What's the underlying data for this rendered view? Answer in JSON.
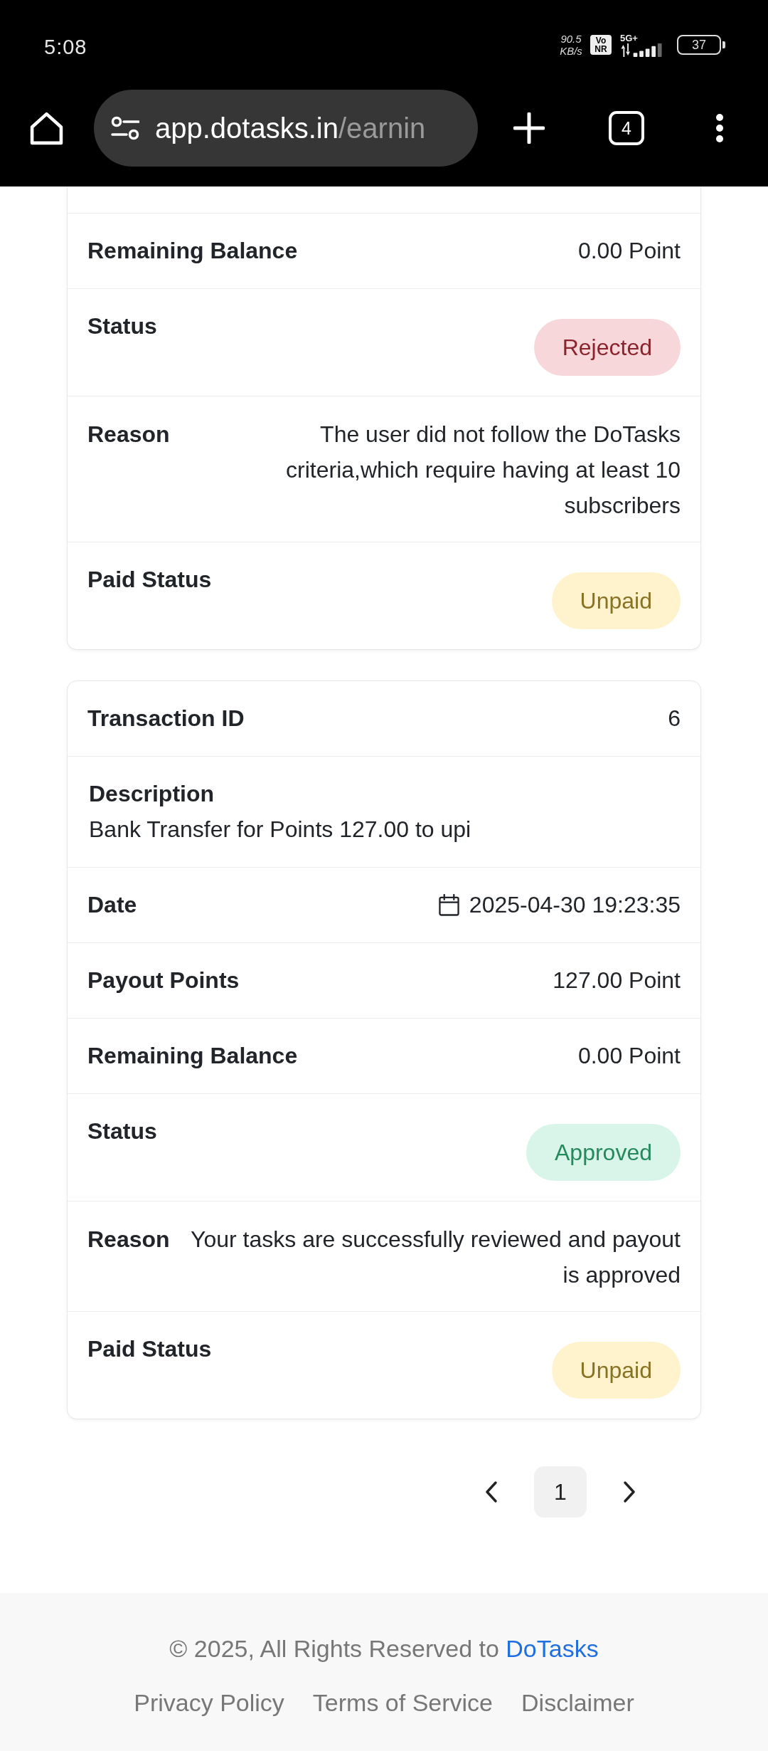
{
  "status_bar": {
    "time": "5:08",
    "network_speed": "90.5 KB/s",
    "voice_badge": "Vo NR",
    "network_type": "5G+",
    "battery": "37"
  },
  "browser_bar": {
    "url_host": "app.dotasks.in",
    "url_path": "/earnin",
    "tab_count": "4"
  },
  "cards": [
    {
      "clipped": true,
      "rows": [
        {
          "kind": "text",
          "label": "Remaining Balance",
          "value": "0.00 Point"
        },
        {
          "kind": "badge",
          "label": "Status",
          "value": "Rejected",
          "color": "#f8d7da"
        },
        {
          "kind": "reason",
          "label": "Reason",
          "value": "The user did not follow the DoTasks criteria,which require having at least 10 subscribers"
        },
        {
          "kind": "badge",
          "label": "Paid Status",
          "value": "Unpaid",
          "color": "#fff3cd"
        }
      ]
    },
    {
      "clipped": false,
      "rows": [
        {
          "kind": "text",
          "label": "Transaction ID",
          "value": "6"
        },
        {
          "kind": "description",
          "label": "Description",
          "value": "Bank Transfer for Points 127.00 to upi"
        },
        {
          "kind": "date",
          "label": "Date",
          "value": "2025-04-30 19:23:35"
        },
        {
          "kind": "text",
          "label": "Payout Points",
          "value": "127.00 Point"
        },
        {
          "kind": "text",
          "label": "Remaining Balance",
          "value": "0.00 Point"
        },
        {
          "kind": "badge",
          "label": "Status",
          "value": "Approved",
          "color": "#d9f5e9"
        },
        {
          "kind": "reason",
          "label": "Reason",
          "value": "Your tasks are successfully reviewed and payout is approved"
        },
        {
          "kind": "badge",
          "label": "Paid Status",
          "value": "Unpaid",
          "color": "#fff3cd"
        }
      ]
    }
  ],
  "pagination": {
    "pages": [
      {
        "label": "1",
        "selected": true
      }
    ]
  },
  "footer": {
    "copyright": "© 2025, All Rights Reserved to",
    "brand_link": "DoTasks",
    "links": [
      "Privacy Policy",
      "Terms of Service",
      "Disclaimer"
    ]
  }
}
